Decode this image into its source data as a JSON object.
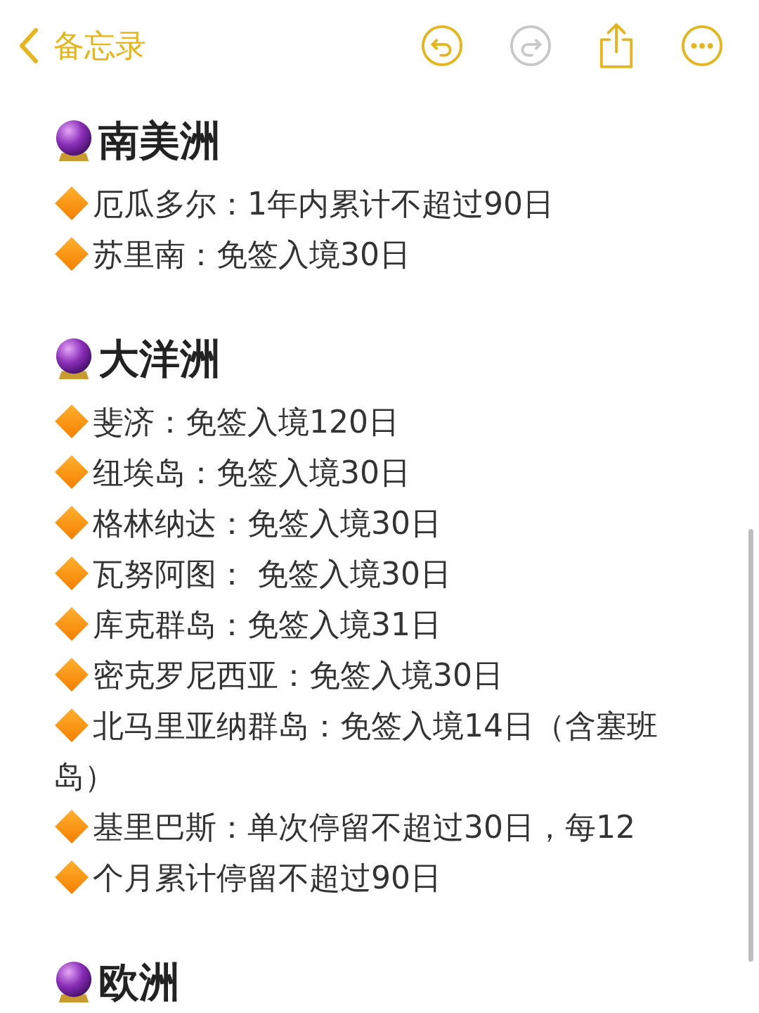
{
  "nav": {
    "back_label": "备忘录",
    "actions": [
      {
        "kind": "undo",
        "disabled": false
      },
      {
        "kind": "redo",
        "disabled": true
      },
      {
        "kind": "share",
        "disabled": false
      },
      {
        "kind": "more",
        "disabled": false
      }
    ]
  },
  "sections": [
    {
      "title": "南美洲",
      "items": [
        {
          "segments": [
            "厄瓜多尔：1年内累计不超过90日"
          ]
        },
        {
          "segments": [
            "苏里南：免签入境30日"
          ]
        }
      ]
    },
    {
      "title": "大洋洲",
      "items": [
        {
          "segments": [
            "斐济：免签入境120日"
          ]
        },
        {
          "segments": [
            "纽埃岛：免签入境30日"
          ]
        },
        {
          "segments": [
            "格林纳达：免签入境30日"
          ]
        },
        {
          "segments": [
            "瓦努阿图： 免签入境30日"
          ]
        },
        {
          "segments": [
            "库克群岛：免签入境31日"
          ]
        },
        {
          "segments": [
            "密克罗尼西亚：免签入境30日"
          ]
        },
        {
          "segments": [
            "北马里亚纳群岛：免签入境14日（含塞班岛）"
          ]
        },
        {
          "segments": [
            "基里巴斯：单次停留不超过30日，每12",
            "个月累计停留不超过90日"
          ]
        }
      ]
    },
    {
      "title": "欧洲"
    }
  ]
}
